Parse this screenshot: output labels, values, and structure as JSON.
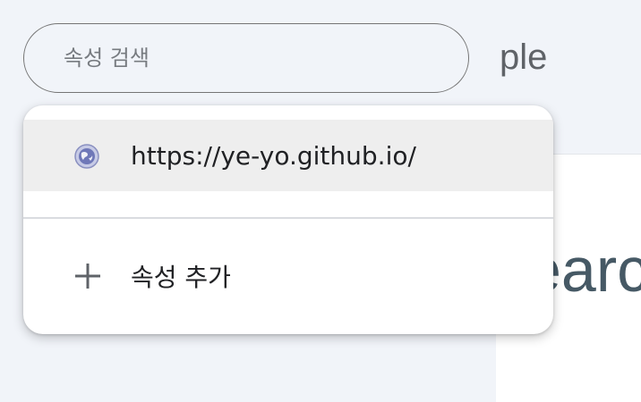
{
  "background": {
    "header_title": "ple",
    "heading": "earc"
  },
  "search": {
    "placeholder": "속성 검색"
  },
  "dropdown": {
    "items": [
      {
        "label": "https://ye-yo.github.io/",
        "icon": "globe-icon",
        "selected": true
      }
    ],
    "add_label": "속성 추가",
    "add_icon": "plus-icon"
  },
  "colors": {
    "panel_bg": "#f1f4f9",
    "selected_bg": "#eeeeee",
    "heading_color": "#465965"
  }
}
